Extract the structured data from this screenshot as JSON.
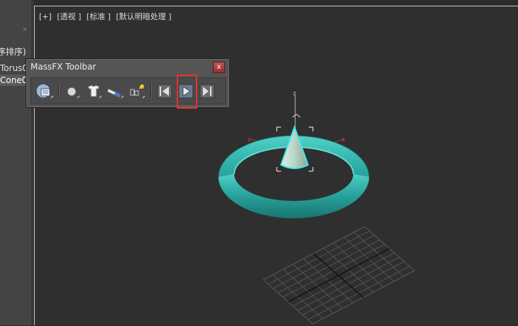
{
  "scene_explorer": {
    "toggle_icon": "double-chevron-right",
    "header": "序排序)",
    "rows": [
      "Torus0",
      "Cone0"
    ]
  },
  "viewport": {
    "labels": [
      "[+]",
      "[透视 ]",
      "[标准 ]",
      "[默认明暗处理 ]"
    ],
    "axis_z": "z",
    "axis_x": "x"
  },
  "massfx_toolbar": {
    "title": "MassFX Toolbar",
    "close_label": "x",
    "buttons": [
      "explorer-icon",
      "rigid-body-icon",
      "cloth-icon",
      "constraint-icon",
      "particle-icon",
      "reset-simulation-icon",
      "start-simulation-icon",
      "step-simulation-icon"
    ]
  },
  "colors": {
    "torus": "#2aa6a0",
    "cone": "#a8c8b8",
    "highlight": "#e83030"
  }
}
